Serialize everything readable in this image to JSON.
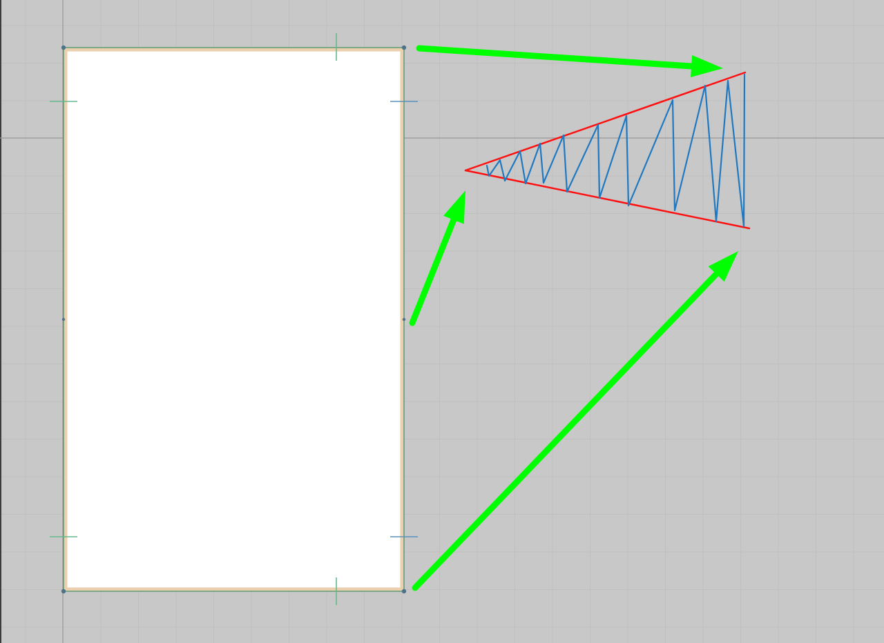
{
  "canvas": {
    "background": "#c8c8c8",
    "grid_minor": "#bdbdbd",
    "guide_line": "#9a9a9a"
  },
  "colors": {
    "panel_fill": "#ffffff",
    "panel_edge_warm": "#ebcfaf",
    "panel_edge_green": "#5d9a72",
    "handle": "#4c7388",
    "tick_green": "#63b98c",
    "tick_blue": "#5a90bb",
    "arrow": "#00ff00",
    "triangle": "#ff1010",
    "zigzag": "#1f78c0"
  },
  "icons": {
    "handle": "anchor-handle-icon",
    "arrow": "arrow-icon"
  }
}
